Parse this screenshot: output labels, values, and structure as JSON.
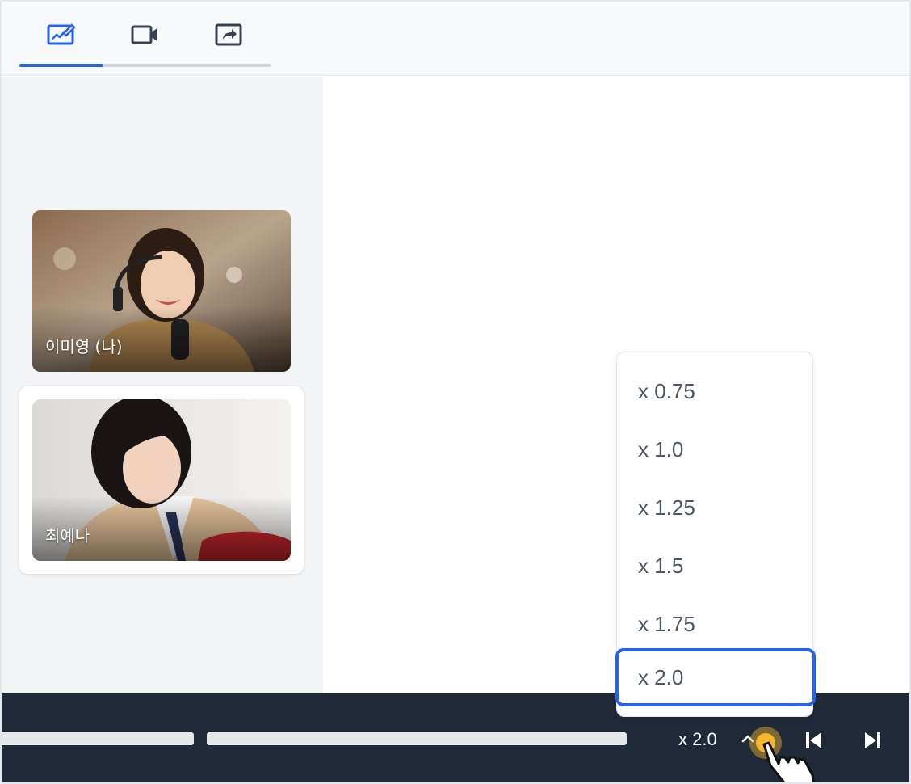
{
  "tabs": [
    {
      "icon": "whiteboard-icon",
      "active": true
    },
    {
      "icon": "video-camera-icon",
      "active": false
    },
    {
      "icon": "screen-share-icon",
      "active": false
    }
  ],
  "participants": [
    {
      "name": "이미영 (나)"
    },
    {
      "name": "최예나"
    }
  ],
  "player": {
    "speed_label": "x 2.0",
    "icons": [
      "chevron-up-icon",
      "skip-previous-icon",
      "skip-next-icon"
    ]
  },
  "speed_menu": {
    "options": [
      "x 0.75",
      "x 1.0",
      "x 1.25",
      "x 1.5",
      "x 1.75",
      "x 2.0"
    ],
    "selected": "x 2.0"
  },
  "colors": {
    "accent": "#2563eb",
    "control_bar": "#202938",
    "sidebar_bg": "#f3f4f6",
    "cursor_highlight": "#f5b82e"
  }
}
